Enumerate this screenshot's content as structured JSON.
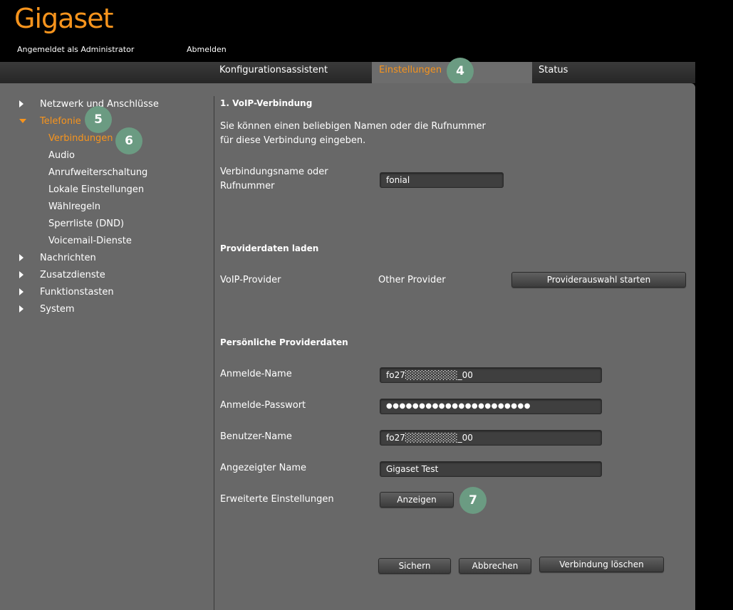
{
  "header": {
    "logo": "Gigaset",
    "login_info": "Angemeldet als Administrator",
    "logout": "Abmelden"
  },
  "tabs": {
    "wizard": "Konfigurationsassistent",
    "settings": "Einstellungen",
    "status": "Status"
  },
  "sidebar": {
    "network": "Netzwerk und Anschlüsse",
    "telephony": "Telefonie",
    "connections": "Verbindungen",
    "audio": "Audio",
    "call_forwarding": "Anrufweiterschaltung",
    "local_settings": "Lokale Einstellungen",
    "dial_rules": "Wählregeln",
    "block_list": "Sperrliste (DND)",
    "voicemail": "Voicemail-Dienste",
    "messages": "Nachrichten",
    "additional_services": "Zusatzdienste",
    "function_keys": "Funktionstasten",
    "system": "System"
  },
  "main": {
    "voip_title": "1. VoIP-Verbindung",
    "intro_line1": "Sie können einen beliebigen Namen oder die Rufnummer",
    "intro_line2": "für diese Verbindung eingeben.",
    "conn_name_label_1": "Verbindungsname oder",
    "conn_name_label_2": "Rufnummer",
    "conn_name_value": "fonial",
    "provider_title": "Providerdaten laden",
    "voip_provider_label": "VoIP-Provider",
    "voip_provider_value": "Other Provider",
    "provider_button": "Providerauswahl starten",
    "personal_title": "Persönliche Providerdaten",
    "login_name_label": "Anmelde-Name",
    "login_name_value": "fo27░░░░░░░░_00",
    "password_label": "Anmelde-Passwort",
    "password_value": "●●●●●●●●●●●●●●●●●●●●●●",
    "user_name_label": "Benutzer-Name",
    "user_name_value": "fo27░░░░░░░░_00",
    "display_name_label": "Angezeigter Name",
    "display_name_value": "Gigaset Test",
    "advanced_label": "Erweiterte Einstellungen",
    "show_button": "Anzeigen",
    "save_button": "Sichern",
    "cancel_button": "Abbrechen",
    "delete_button": "Verbindung löschen"
  },
  "badges": {
    "b4": "4",
    "b5": "5",
    "b6": "6",
    "b7": "7"
  },
  "colors": {
    "accent": "#f7941d",
    "badge": "#6b9b82",
    "panel": "#686868"
  }
}
